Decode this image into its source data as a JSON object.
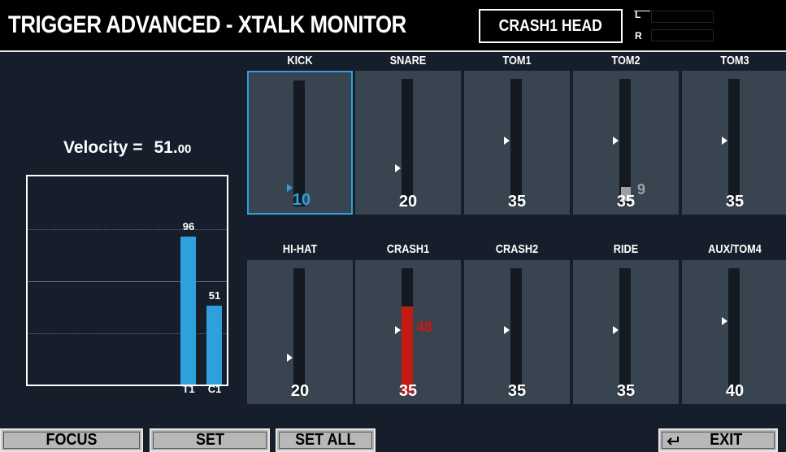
{
  "header": {
    "title": "TRIGGER ADVANCED - XTALK MONITOR",
    "pad_name": "CRASH1 HEAD",
    "meter_l": "L",
    "meter_r": "R"
  },
  "velocity": {
    "label": "Velocity =",
    "value": "51.",
    "decimal": "00"
  },
  "graph": {
    "bars": [
      {
        "label": "T1",
        "value": 96,
        "color": "#2ea0dc"
      },
      {
        "label": "C1",
        "value": 51,
        "color": "#2ea0dc"
      }
    ],
    "max": 128
  },
  "pads": [
    {
      "name": "KICK",
      "value": "10",
      "threshold": 10,
      "selected": true
    },
    {
      "name": "SNARE",
      "value": "20",
      "threshold": 20
    },
    {
      "name": "TOM1",
      "value": "35",
      "threshold": 35
    },
    {
      "name": "TOM2",
      "value": "35",
      "threshold": 35,
      "xtalk_level": 9,
      "xtalk_label": "9"
    },
    {
      "name": "TOM3",
      "value": "35",
      "threshold": 35
    },
    {
      "name": "HI-HAT",
      "value": "20",
      "threshold": 20
    },
    {
      "name": "CRASH1",
      "value": "35",
      "threshold": 35,
      "level": 48,
      "level_label": "48",
      "level_color": "#c41a14"
    },
    {
      "name": "CRASH2",
      "value": "35",
      "threshold": 35
    },
    {
      "name": "RIDE",
      "value": "35",
      "threshold": 35
    },
    {
      "name": "AUX/TOM4",
      "value": "40",
      "threshold": 40
    }
  ],
  "function_buttons": {
    "focus": "FOCUS",
    "set": "SET",
    "set_all": "SET ALL",
    "exit": "EXIT",
    "exit_icon": "return-arrow-icon"
  },
  "colors": {
    "accent": "#2ea0dc",
    "alert": "#c41a14"
  }
}
